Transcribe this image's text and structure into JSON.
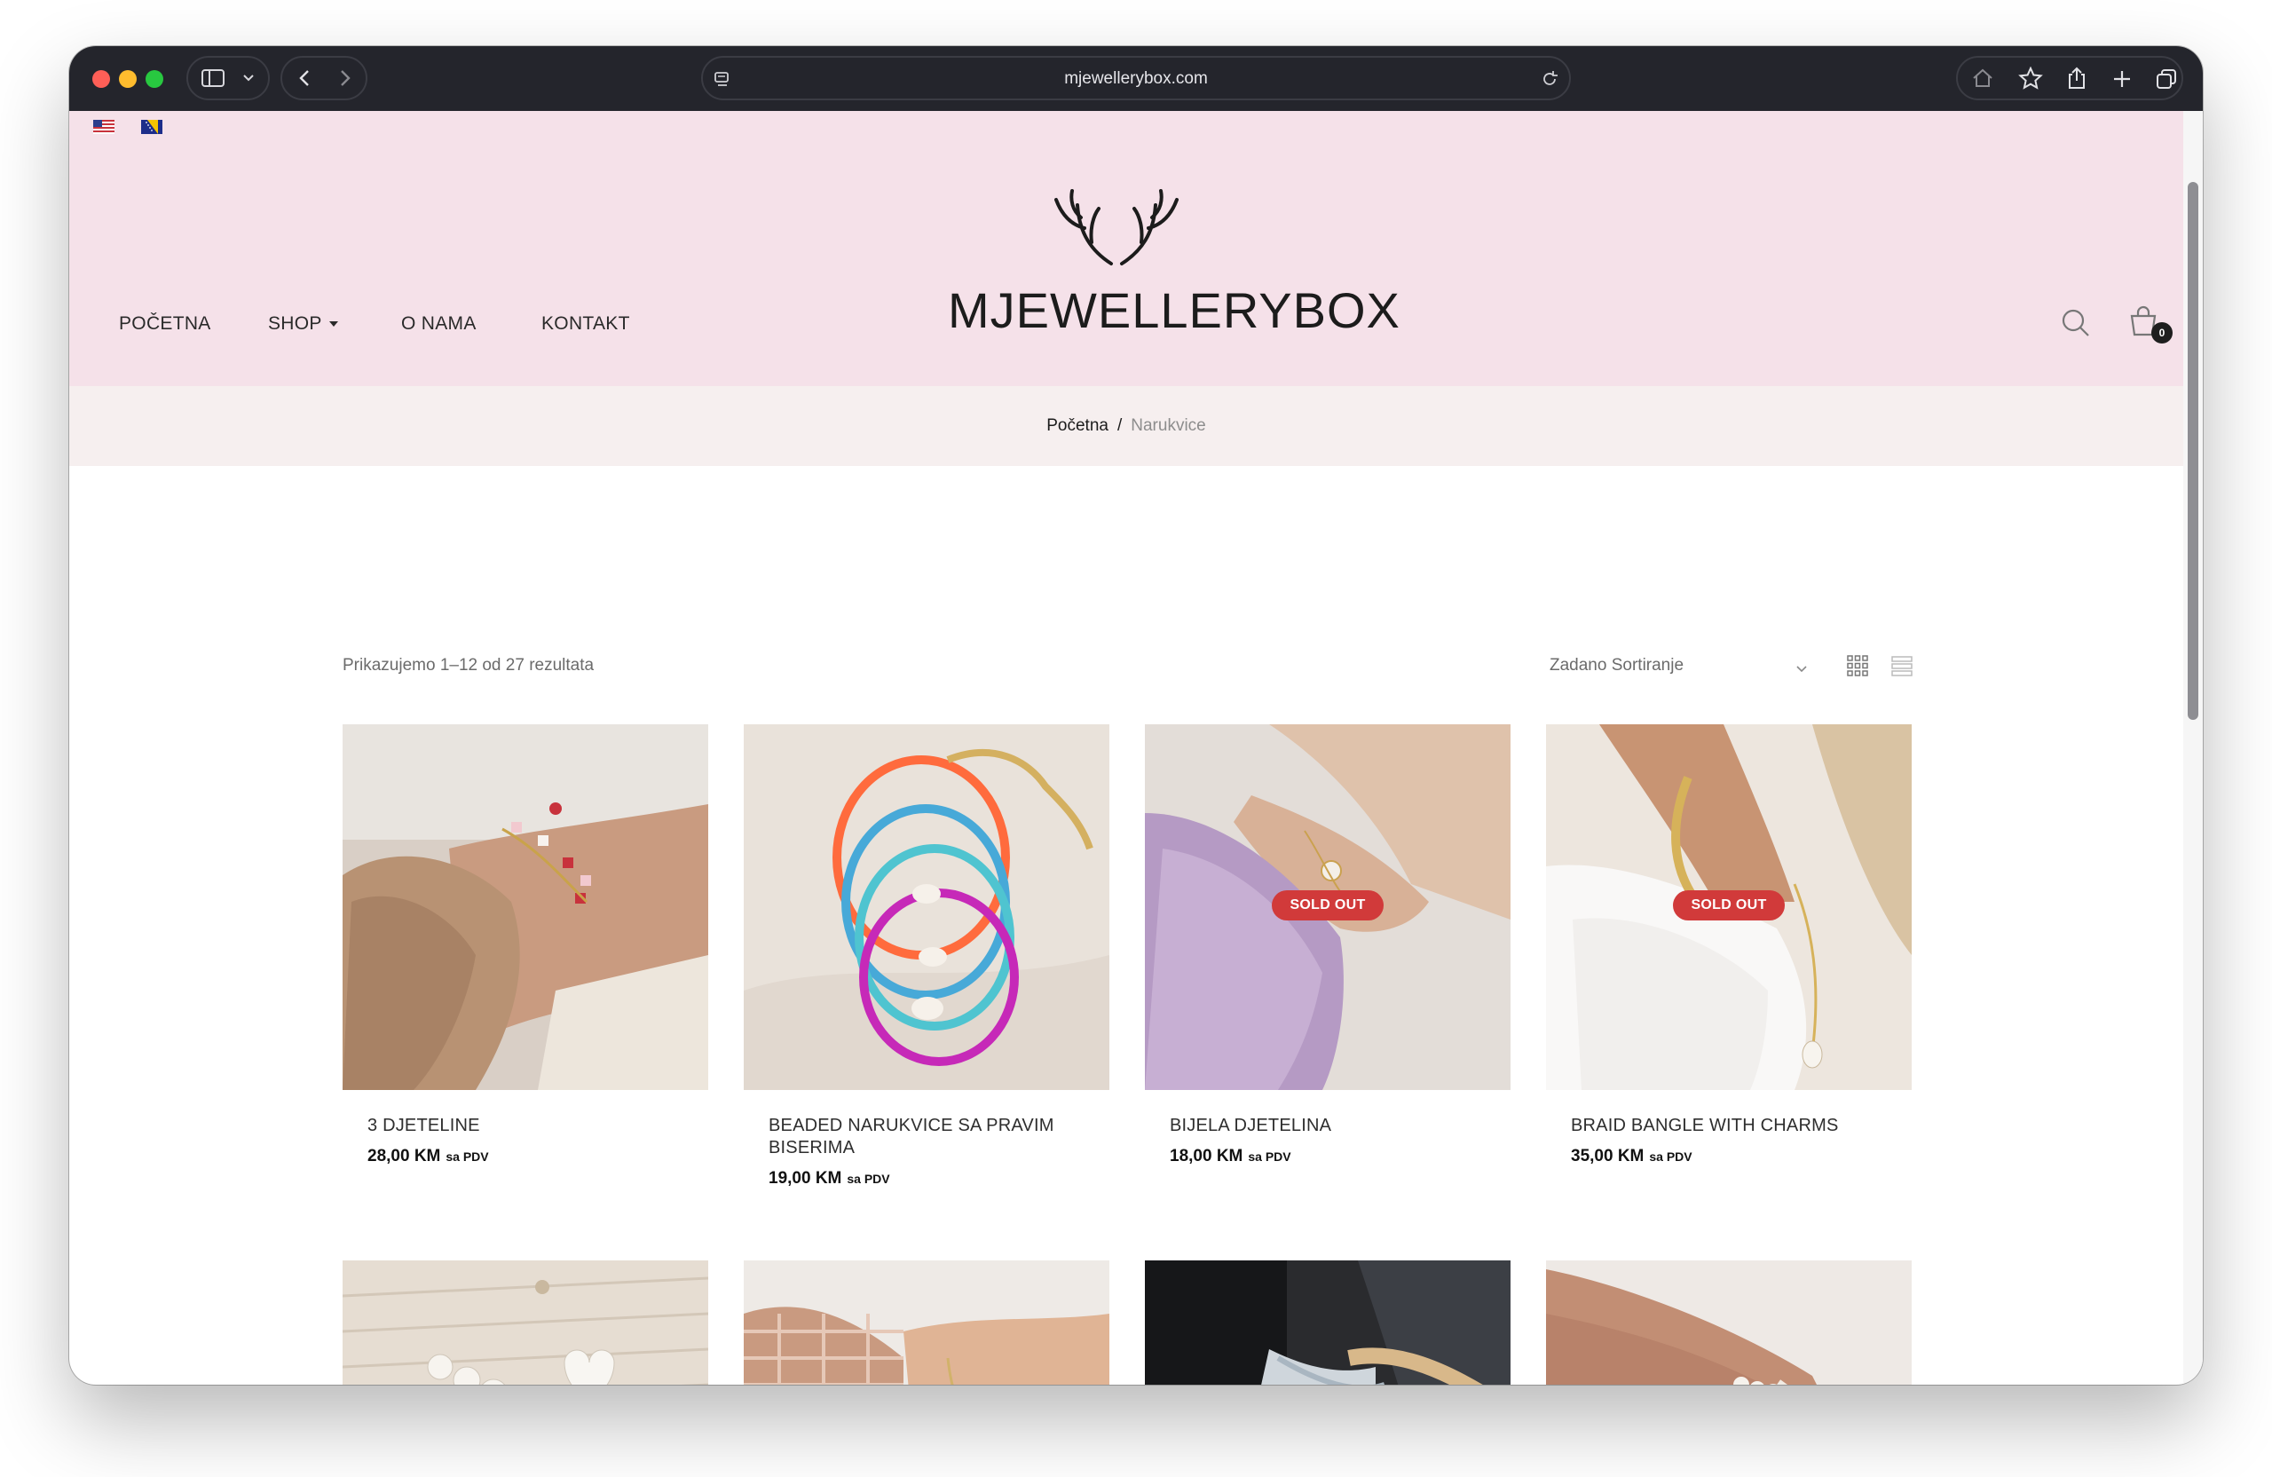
{
  "browser": {
    "url": "mjewellerybox.com"
  },
  "header": {
    "languages": [
      "English",
      "Bosanski"
    ],
    "logo_text": "MJEWELLERYBOX",
    "nav": [
      {
        "label": "POČETNA"
      },
      {
        "label": "SHOP"
      },
      {
        "label": "O NAMA"
      },
      {
        "label": "KONTAKT"
      }
    ],
    "cart_count": "0"
  },
  "breadcrumb": {
    "home": "Početna",
    "separator": "/",
    "current": "Narukvice"
  },
  "shop": {
    "result_count": "Prikazujemo 1–12 od 27 rezultata",
    "sort_label": "Zadano Sortiranje",
    "sold_out_label": "SOLD OUT",
    "tax_label": "sa PDV",
    "products": [
      {
        "name": "3 DJETELINE",
        "price": "28,00 KM",
        "sold_out": false
      },
      {
        "name": "BEADED NARUKVICE SA PRAVIM BISERIMA",
        "price": "19,00 KM",
        "sold_out": false
      },
      {
        "name": "BIJELA DJETELINA",
        "price": "18,00 KM",
        "sold_out": true
      },
      {
        "name": "BRAID BANGLE WITH CHARMS",
        "price": "35,00 KM",
        "sold_out": true
      }
    ]
  },
  "colors": {
    "header_bg": "#f5e1e9",
    "breadcrumb_bg": "#f6efef",
    "sold_out_badge": "#d13a3a"
  }
}
